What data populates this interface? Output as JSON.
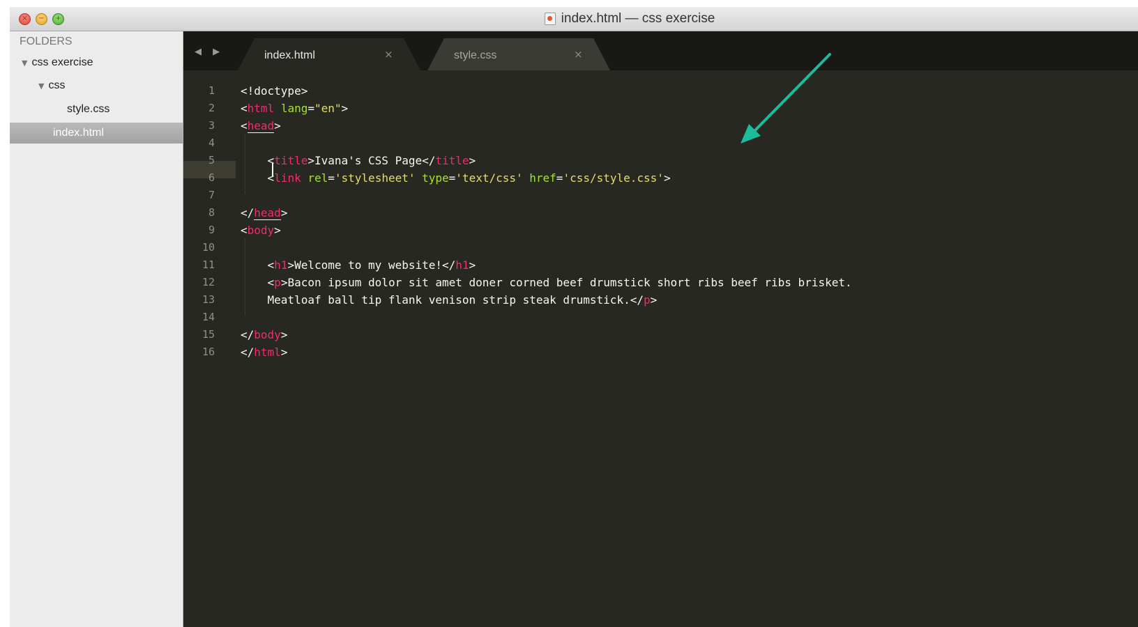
{
  "window": {
    "title": "index.html — css exercise",
    "traffic_lights": [
      "close",
      "minimize",
      "zoom"
    ]
  },
  "sidebar": {
    "heading": "FOLDERS",
    "tree": [
      {
        "label": "css exercise",
        "expanded": true
      },
      {
        "label": "css",
        "expanded": true
      },
      {
        "label": "style.css"
      },
      {
        "label": "index.html",
        "selected": true
      }
    ]
  },
  "tabs": [
    {
      "label": "index.html",
      "active": true,
      "close": "×"
    },
    {
      "label": "style.css",
      "active": false,
      "close": "×"
    }
  ],
  "nav_arrows": "◀ ▶",
  "editor": {
    "current_line": 6,
    "lines": [
      {
        "n": "1",
        "html": "&lt;!doctype&gt;"
      },
      {
        "n": "2",
        "html": "&lt;<span class=\"tg\">html</span> <span class=\"at\">lang</span>=<span class=\"st\">\"en\"</span>&gt;"
      },
      {
        "n": "3",
        "html": "&lt;<span class=\"tg ul\">head</span>&gt;"
      },
      {
        "n": "4",
        "html": ""
      },
      {
        "n": "5",
        "html": "    &lt;<span class=\"tg\">title</span>&gt;Ivana's CSS Page&lt;/<span class=\"tg\">title</span>&gt;"
      },
      {
        "n": "6",
        "html": "    &lt;<span class=\"tg\">link</span> <span class=\"at\">rel</span>=<span class=\"st\">'stylesheet'</span> <span class=\"at\">type</span>=<span class=\"st\">'text/css'</span> <span class=\"at\">href</span>=<span class=\"st\">'css/style.css'</span>&gt;"
      },
      {
        "n": "7",
        "html": ""
      },
      {
        "n": "8",
        "html": "&lt;/<span class=\"tg ul\">head</span>&gt;"
      },
      {
        "n": "9",
        "html": "&lt;<span class=\"tg\">body</span>&gt;"
      },
      {
        "n": "10",
        "html": ""
      },
      {
        "n": "11",
        "html": "    &lt;<span class=\"tg\">h1</span>&gt;Welcome to my website!&lt;/<span class=\"tg\">h1</span>&gt;"
      },
      {
        "n": "12",
        "html": "    &lt;<span class=\"tg\">p</span>&gt;Bacon ipsum dolor sit amet doner corned beef drumstick short ribs beef ribs brisket."
      },
      {
        "n": "13",
        "html": "    Meatloaf ball tip flank venison strip steak drumstick.&lt;/<span class=\"tg\">p</span>&gt;"
      },
      {
        "n": "14",
        "html": ""
      },
      {
        "n": "15",
        "html": "&lt;/<span class=\"tg\">body</span>&gt;"
      },
      {
        "n": "16",
        "html": "&lt;/<span class=\"tg\">html</span>&gt;"
      }
    ]
  },
  "colors": {
    "editor_bg": "#272822",
    "tag": "#f92672",
    "attribute": "#a6e22e",
    "string": "#e6db74",
    "annotation_arrow": "#1abc9c"
  }
}
